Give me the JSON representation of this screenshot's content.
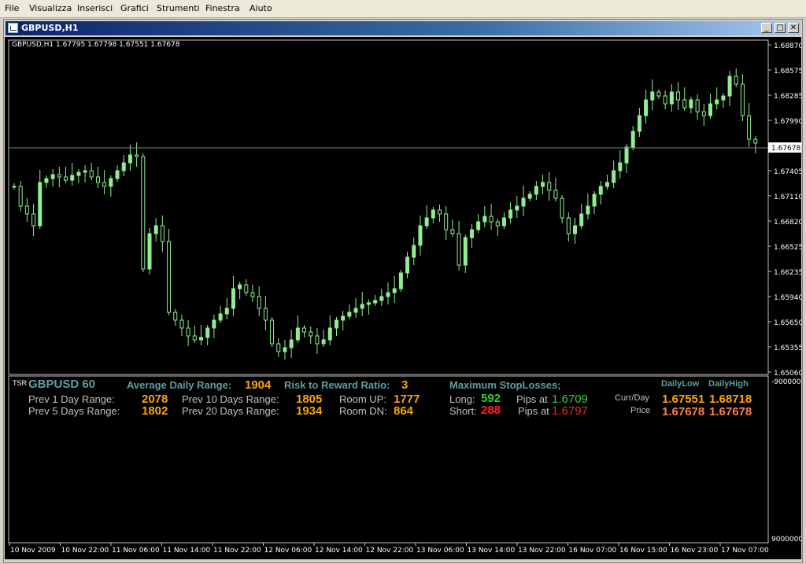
{
  "menu": [
    "File",
    "Visualizza",
    "Inserisci",
    "Grafici",
    "Strumenti",
    "Finestra",
    "Aiuto"
  ],
  "window": {
    "title": "GBPUSD,H1"
  },
  "chart": {
    "info_line": "GBPUSD,H1  1.67795 1.67798 1.67551 1.67678",
    "price_labels": [
      "1.68870",
      "1.68575",
      "1.68285",
      "1.67990",
      "1.67405",
      "1.67110",
      "1.66820",
      "1.66525",
      "1.66235",
      "1.65940",
      "1.65650",
      "1.65355",
      "1.65060"
    ],
    "current_price": "1.67678",
    "time_labels": [
      "10 Nov 2009",
      "10 Nov 22:00",
      "11 Nov 06:00",
      "11 Nov 14:00",
      "11 Nov 22:00",
      "12 Nov 06:00",
      "12 Nov 14:00",
      "12 Nov 22:00",
      "13 Nov 06:00",
      "13 Nov 14:00",
      "13 Nov 22:00",
      "16 Nov 07:00",
      "16 Nov 15:00",
      "16 Nov 23:00",
      "17 Nov 07:00"
    ],
    "candle_color": "#90ee90",
    "grid_line_color": "#708090"
  },
  "indicator": {
    "tag": "TSR",
    "symbol": "GBPUSD 60",
    "adr_label": "Average Daily Range:",
    "adr_value": "1904",
    "rr_label": "Risk to Reward Ratio:",
    "rr_value": "3",
    "prev1_label": "Prev 1 Day Range:",
    "prev1_value": "2078",
    "prev5_label": "Prev 5 Days Range:",
    "prev5_value": "1802",
    "prev10_label": "Prev 10 Days Range:",
    "prev10_value": "1805",
    "prev20_label": "Prev 20 Days Range:",
    "prev20_value": "1934",
    "room_up_label": "Room UP:",
    "room_up_value": "1777",
    "room_dn_label": "Room DN:",
    "room_dn_value": "864",
    "max_sl_label": "Maximum StopLosses;",
    "long_label": "Long:",
    "long_value": "592",
    "long_pips_label": "Pips at",
    "long_price": "1.6709",
    "short_label": "Short:",
    "short_value": "288",
    "short_pips_label": "Pips at",
    "short_price": "1.6797",
    "daily_low_header": "DailyLow",
    "daily_high_header": "DailyHigh",
    "currday_label": "Curr/Day",
    "currday_low": "1.67551",
    "currday_high": "1.68718",
    "price_label": "Price",
    "price_low": "1.67678",
    "price_high": "1.67678",
    "scale_top": "9000000",
    "scale_bottom": "-9000000"
  }
}
